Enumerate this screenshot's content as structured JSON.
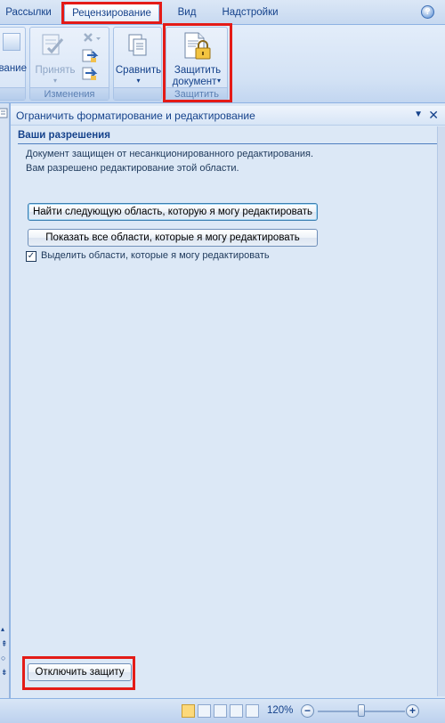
{
  "tabs": {
    "mailings": "Рассылки",
    "review": "Рецензирование",
    "view": "Вид",
    "addins": "Надстройки",
    "help": "?"
  },
  "ribbon": {
    "left_partial": "вание",
    "accept": "Принять",
    "changes_group": "Изменения",
    "compare": "Сравнить",
    "protect_line1": "Защитить",
    "protect_line2": "документ",
    "protect_group": "Защитить"
  },
  "pane": {
    "title": "Ограничить форматирование и редактирование",
    "section_title": "Ваши разрешения",
    "message_line1": "Документ защищен от несанкционированного редактирования.",
    "message_line2": "Вам разрешено редактирование этой области.",
    "find_next_button": "Найти следующую область, которую я могу редактировать",
    "show_all_button": "Показать все области, которые я могу редактировать",
    "highlight_checkbox_label": "Выделить области, которые я могу редактировать",
    "highlight_checked": true,
    "stop_protection_button": "Отключить защиту"
  },
  "status": {
    "zoom": "120%",
    "zoom_minus": "−",
    "zoom_plus": "+",
    "zoom_level_fraction": 0.5
  },
  "colors": {
    "highlight": "#e41b17",
    "ribbon_text": "#15428b"
  }
}
